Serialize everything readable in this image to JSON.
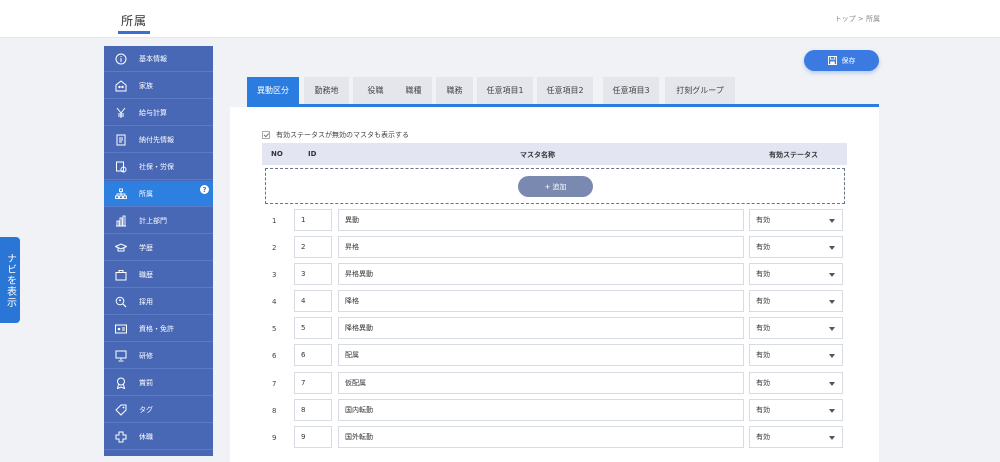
{
  "header": {
    "title": "所属",
    "breadcrumb": "トップ > 所属"
  },
  "nav_toggle": {
    "label": "ナビを表示"
  },
  "sidebar": {
    "items": [
      {
        "label": "基本情報",
        "icon": "info-icon"
      },
      {
        "label": "家族",
        "icon": "family-icon"
      },
      {
        "label": "給与計算",
        "icon": "yen-icon"
      },
      {
        "label": "納付先情報",
        "icon": "document-icon"
      },
      {
        "label": "社保・労保",
        "icon": "insurance-icon"
      },
      {
        "label": "所属",
        "icon": "org-chart-icon",
        "active": true
      },
      {
        "label": "計上部門",
        "icon": "bar-chart-icon"
      },
      {
        "label": "学歴",
        "icon": "graduation-cap-icon"
      },
      {
        "label": "職歴",
        "icon": "briefcase-icon"
      },
      {
        "label": "採用",
        "icon": "search-person-icon"
      },
      {
        "label": "資格・免許",
        "icon": "id-card-icon"
      },
      {
        "label": "研修",
        "icon": "presentation-icon"
      },
      {
        "label": "賞罰",
        "icon": "award-icon"
      },
      {
        "label": "タグ",
        "icon": "tag-icon"
      },
      {
        "label": "休職",
        "icon": "cross-icon"
      }
    ],
    "help_badge": "?"
  },
  "toolbar": {
    "save_label": "保存"
  },
  "tabs": [
    {
      "label": "異動区分",
      "active": true
    },
    {
      "label": "勤務地"
    },
    {
      "label": "役職"
    },
    {
      "label": "職種"
    },
    {
      "label": "職務"
    },
    {
      "label": "任意項目1"
    },
    {
      "label": "任意項目2"
    },
    {
      "label": "任意項目3"
    },
    {
      "label": "打刻グループ"
    }
  ],
  "filter": {
    "show_inactive_label": "有効ステータスが無効のマスタも表示する"
  },
  "table": {
    "columns": {
      "no": "NO",
      "id": "ID",
      "name": "マスタ名称",
      "status": "有効ステータス"
    },
    "add_label": "+ 追加",
    "rows": [
      {
        "no": "1",
        "id": "1",
        "name": "異動",
        "status": "有効"
      },
      {
        "no": "2",
        "id": "2",
        "name": "昇格",
        "status": "有効"
      },
      {
        "no": "3",
        "id": "3",
        "name": "昇格異動",
        "status": "有効"
      },
      {
        "no": "4",
        "id": "4",
        "name": "降格",
        "status": "有効"
      },
      {
        "no": "5",
        "id": "5",
        "name": "降格異動",
        "status": "有効"
      },
      {
        "no": "6",
        "id": "6",
        "name": "配属",
        "status": "有効"
      },
      {
        "no": "7",
        "id": "7",
        "name": "仮配属",
        "status": "有効"
      },
      {
        "no": "8",
        "id": "8",
        "name": "国内転勤",
        "status": "有効"
      },
      {
        "no": "9",
        "id": "9",
        "name": "国外転勤",
        "status": "有効"
      }
    ]
  },
  "colors": {
    "accent": "#2b7ce0",
    "sidebar": "#4868b5",
    "sidebar_active": "#2d7fe0",
    "add_button": "#7a89b0"
  }
}
